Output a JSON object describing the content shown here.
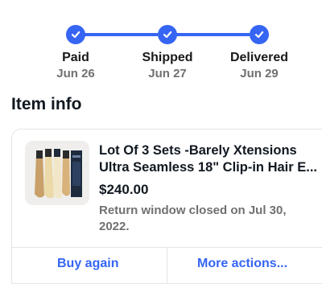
{
  "tracker": {
    "steps": [
      {
        "label": "Paid",
        "date": "Jun 26"
      },
      {
        "label": "Shipped",
        "date": "Jun 27"
      },
      {
        "label": "Delivered",
        "date": "Jun 29"
      }
    ],
    "accent_color": "#3665f3"
  },
  "item_info": {
    "heading": "Item info",
    "title_line1": "Lot Of 3 Sets -Barely Xtensions",
    "title_line2": "Ultra Seamless 18\" Clip-in Hair E...",
    "price": "$240.00",
    "return_status": "Return window closed on Jul 30, 2022.",
    "image_icon": "hair-extensions-product-image"
  },
  "actions": {
    "buy_again": "Buy again",
    "more_actions": "More actions..."
  }
}
